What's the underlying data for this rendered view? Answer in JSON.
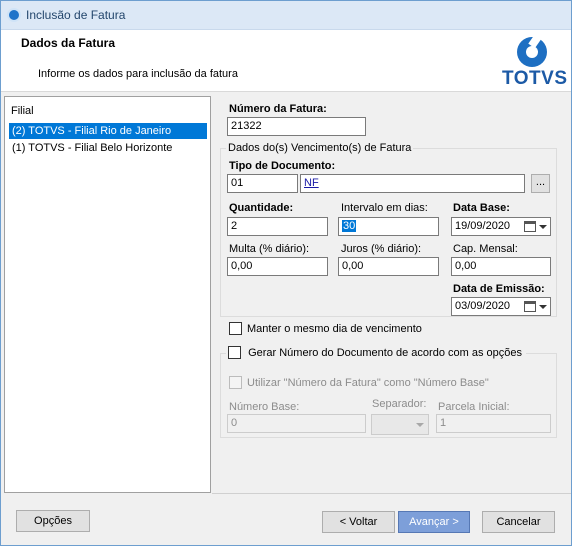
{
  "window": {
    "title": "Inclusão de Fatura"
  },
  "header": {
    "title": "Dados da Fatura",
    "subtitle": "Informe os dados para inclusão da fatura",
    "logo_text": "TOTVS"
  },
  "filial": {
    "header": "Filial",
    "items": [
      {
        "label": "(2) TOTVS - Filial Rio de Janeiro",
        "selected": true
      },
      {
        "label": "(1) TOTVS - Filial Belo Horizonte",
        "selected": false
      }
    ]
  },
  "form": {
    "numero_fatura_label": "Número da Fatura:",
    "numero_fatura_value": "21322",
    "vencimentos_group": "Dados do(s) Vencimento(s) de Fatura",
    "tipo_documento_label": "Tipo de Documento:",
    "tipo_documento_code": "01",
    "tipo_documento_desc": "NF",
    "lookup_button": "...",
    "quantidade_label": "Quantidade:",
    "quantidade_value": "2",
    "intervalo_label": "Intervalo em dias:",
    "intervalo_value": "30",
    "data_base_label": "Data Base:",
    "data_base_value": "19/09/2020",
    "multa_label": "Multa (% diário):",
    "multa_value": "0,00",
    "juros_label": "Juros (% diário):",
    "juros_value": "0,00",
    "cap_mensal_label": "Cap. Mensal:",
    "cap_mensal_value": "0,00",
    "data_emissao_label": "Data de Emissão:",
    "data_emissao_value": "03/09/2020",
    "manter_dia_label": "Manter o mesmo dia de vencimento",
    "gerar_numero_label": "Gerar Número do Documento de acordo com as opções",
    "utilizar_numero_label": "Utilizar \"Número da Fatura\" como \"Número Base\"",
    "numero_base_label": "Número Base:",
    "numero_base_value": "0",
    "separador_label": "Separador:",
    "parcela_inicial_label": "Parcela Inicial:",
    "parcela_inicial_value": "1"
  },
  "buttons": {
    "opcoes": "Opções",
    "voltar": "< Voltar",
    "avancar": "Avançar >",
    "cancelar": "Cancelar"
  },
  "icons": {
    "title_icon": "totvs-app-icon",
    "calendar": "calendar-icon",
    "dropdown": "chevron-down-icon"
  },
  "colors": {
    "selection": "#0078d7",
    "primary_button": "#7d9fd9",
    "logo_blue": "#1c5aa6"
  }
}
